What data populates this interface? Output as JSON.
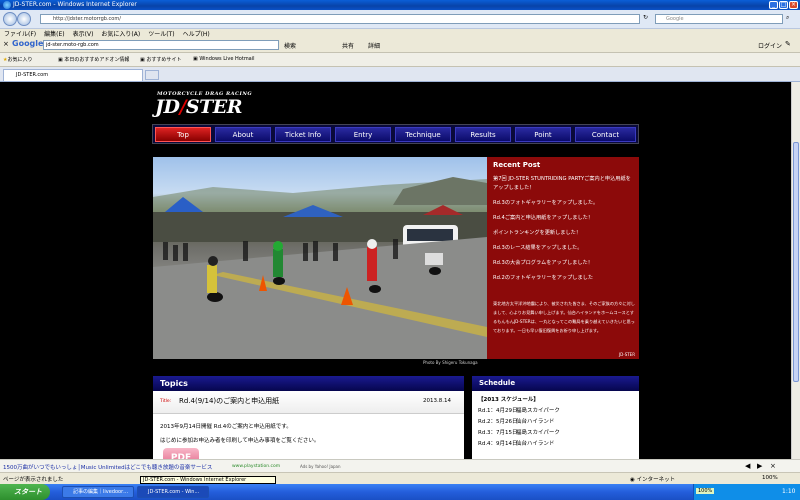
{
  "window": {
    "title": "JD-STER.com - Windows Internet Explorer"
  },
  "address": {
    "url": "http://jdster.motorrgb.com/",
    "search_placeholder": "Google"
  },
  "menu": [
    "ファイル(F)",
    "編集(E)",
    "表示(V)",
    "お気に入り(A)",
    "ツール(T)",
    "ヘルプ(H)"
  ],
  "google_toolbar": {
    "query": "jd-ster.moto-rgb.com",
    "search_label": "検索",
    "share_label": "共有",
    "more_label": "詳細",
    "login_label": "ログイン"
  },
  "favorites": {
    "label": "お気に入り",
    "items": [
      "本日のおすすめアドオン情報",
      "おすすめサイト",
      "Windows Live Hotmail"
    ]
  },
  "tab": {
    "label": "JD-STER.com"
  },
  "site": {
    "logo_sub": "MOTORCYCLE DRAG RACING",
    "logo_main_left": "JD",
    "logo_main_slash": "/",
    "logo_main_right": "STER",
    "nav": [
      "Top",
      "About",
      "Ticket Info",
      "Entry",
      "Technique",
      "Results",
      "Point",
      "Contact"
    ],
    "photo_credit": "Photo By Shigeru Tokunaga",
    "recent": {
      "title": "Recent Post",
      "posts": [
        "第7回 JD-STER STUNTRIDING PARTYご案内と申込用紙をアップしました！",
        "Rd.3のフォトギャラリーをアップしました。",
        "Rd.4ご案内と申込用紙をアップしました！",
        "ポイントランキングを更新しました！",
        "Rd.3のレース結果をアップしました。",
        "Rd.3の大会プログラムをアップしました！",
        "Rd.2のフォトギャラリーをアップしました"
      ],
      "message": "東北地方太平洋沖地震により、被災された皆さま、そのご家族の方々に対しまして、心よりお見舞い申し上げます。仙台ハイランドをホームコースとするもんもんJD-STERは、一丸となってこの難局を乗り越えていきたいと思っております。一日も早い復旧復興をお祈り申し上げます。",
      "signature": "JD-STER"
    },
    "topics": {
      "title": "Topics",
      "item_label": "Title:",
      "item_title": "Rd.4(9/14)のご案内と申込用紙",
      "item_date": "2013.8.14",
      "body1": "2013年9月14日開催 Rd.4のご案内と申込用紙です。",
      "body2": "はじめに参加お申込み者を印刷して申込み事項をご覧ください。",
      "pdf_label": "PDF"
    },
    "schedule": {
      "title": "Schedule",
      "year_label": "【2013 スケジュール】",
      "rows": [
        {
          "round": "Rd.1：4月29日",
          "venue": "福島スカイパーク"
        },
        {
          "round": "Rd.2：5月26日",
          "venue": "仙台ハイランド"
        },
        {
          "round": "Rd.3：7月15日",
          "venue": "福島スカイパーク"
        },
        {
          "round": "Rd.4：9月14日",
          "venue": "仙台ハイランド"
        }
      ]
    }
  },
  "adbar": {
    "text": "1500万曲がいつでもいっしょ│Music Unlimitedはどこでも聴き放題の音楽サービス",
    "url": "www.playstation.com",
    "credit": "Ads by Yahoo! Japan"
  },
  "status": {
    "text": "ページが表示されました",
    "zone": "インターネット",
    "zoom": "100%"
  },
  "tooltip": "JD-STER.com - Windows Internet Explorer",
  "taskbar": {
    "start": "スタート",
    "tasks": [
      "記事の編集｜livedoor…",
      "JD-STER.com - Win..."
    ],
    "zoom": "100%",
    "clock": "1:10"
  }
}
